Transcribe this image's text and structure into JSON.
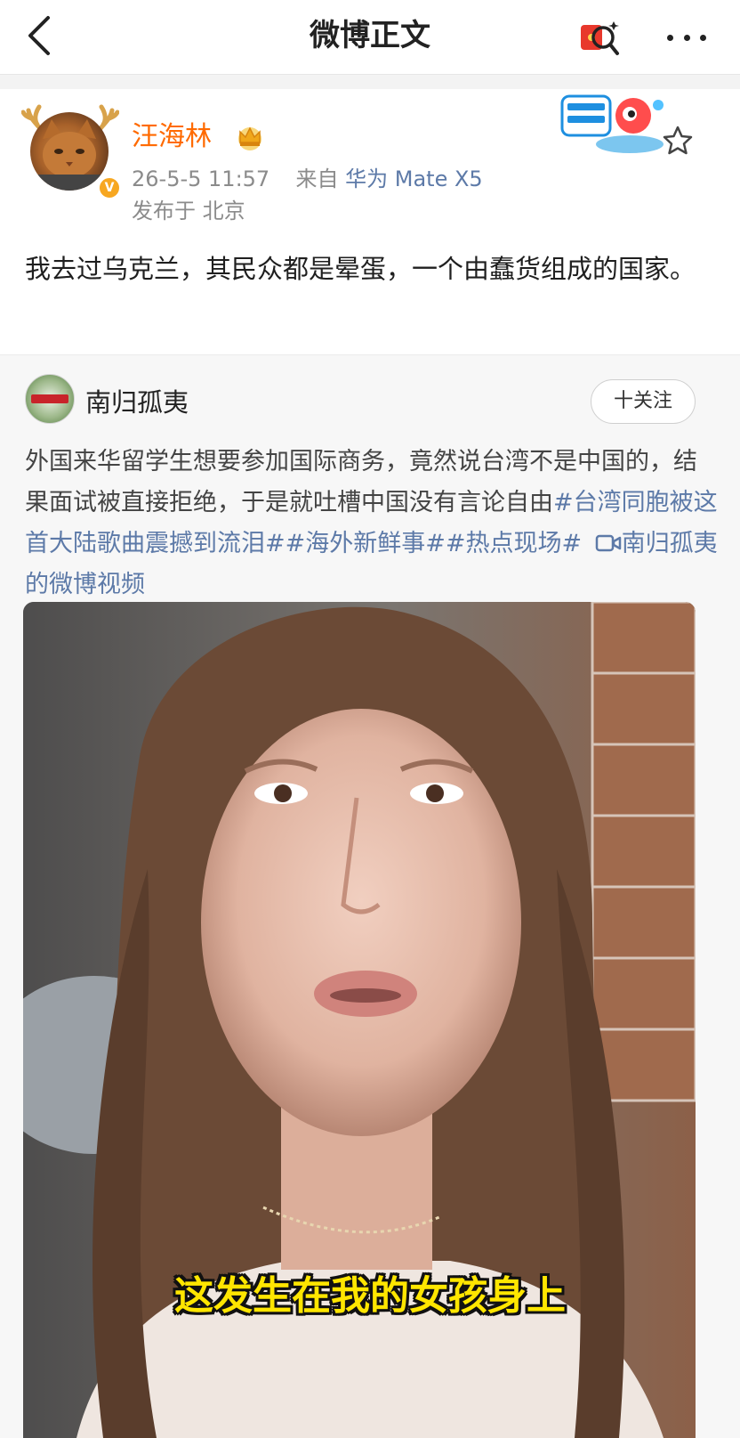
{
  "header": {
    "title": "微博正文"
  },
  "post": {
    "author": "汪海林",
    "timestamp": "26-5-5 11:57",
    "source_prefix": "来自",
    "device": "华为 Mate X5",
    "location": "发布于 北京",
    "text": "我去过乌克兰，其民众都是晕蛋，一个由蠢货组成的国家。"
  },
  "repost": {
    "author": "南归孤夷",
    "follow_label": "十关注",
    "text_plain": "外国来华留学生想要参加国际商务，竟然说台湾不是中国的，结果面试被直接拒绝，于是就吐槽中国没有言论自由",
    "topics": [
      "#台湾同胞被这首大陆歌曲震撼到流泪#",
      "#海外新鲜事#",
      "#热点现场#"
    ],
    "video_link": "南归孤夷的微博视频"
  },
  "video": {
    "subtitle": "这发生在我的女孩身上"
  },
  "colors": {
    "username": "#ff6a00",
    "link": "#5d7aa8",
    "subtitle": "#ffe600"
  },
  "icons": {
    "back": "chevron-left-icon",
    "red_packet": "red-packet-search-icon",
    "more": "more-dots-icon",
    "crown": "crown-icon",
    "star": "star-icon",
    "video": "video-icon"
  }
}
